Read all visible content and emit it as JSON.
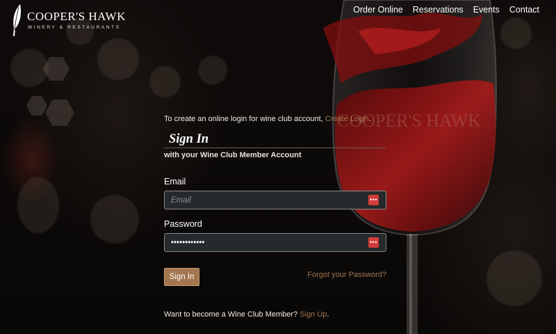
{
  "brand": {
    "name": "COOPER'S HAWK",
    "tagline": "WINERY & RESTAURANTS",
    "glass_etching": "COOPER'S HAWK"
  },
  "nav": {
    "items": [
      {
        "label": "Order Online",
        "name": "nav-order-online"
      },
      {
        "label": "Reservations",
        "name": "nav-reservations"
      },
      {
        "label": "Events",
        "name": "nav-events"
      },
      {
        "label": "Contact",
        "name": "nav-contact"
      }
    ]
  },
  "form": {
    "intro_text": "To create an online login for wine club account, ",
    "intro_link": "Create Login",
    "intro_end": ".",
    "title": "Sign In",
    "subtitle": "with your Wine Club Member Account",
    "email_label": "Email",
    "email_placeholder": "Email",
    "email_value": "",
    "password_label": "Password",
    "password_value": "••••••••••••",
    "field_badge": "•••",
    "signin_button": "Sign In",
    "forgot_link": "Forgot your Password?",
    "signup_text": "Want to become a Wine Club Member? ",
    "signup_link": "Sign Up",
    "signup_end": "."
  },
  "colors": {
    "accent": "#a4764f",
    "badge": "#d33d3a",
    "background": "#0b0908",
    "wine": "#b01a1a"
  },
  "icons": [
    "feather-icon",
    "password-manager-icon"
  ]
}
